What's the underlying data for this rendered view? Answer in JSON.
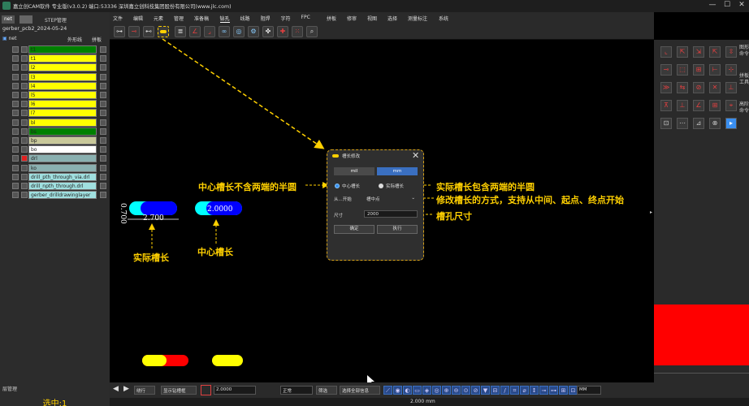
{
  "title": "嘉立创CAM软件 专业版(v3.0.2) 端口:53336    深圳嘉立创科技集团股份有限公司(www.jlc.com)",
  "panel": {
    "tab_net": "net",
    "tab_step": "STEP管理",
    "job": "gerber_pcb2_2024-05-24",
    "net": "net",
    "outline": "外形线",
    "assembly": "拼板",
    "layers_mgr": "层管理",
    "status": "选中:1"
  },
  "layers": [
    {
      "name": "t1",
      "color": "#008000"
    },
    {
      "name": "t1",
      "color": "#ffff00"
    },
    {
      "name": "l2",
      "color": "#ffff00"
    },
    {
      "name": "l3",
      "color": "#ffff00"
    },
    {
      "name": "l4",
      "color": "#ffff00"
    },
    {
      "name": "l5",
      "color": "#ffff00"
    },
    {
      "name": "l6",
      "color": "#ffff00"
    },
    {
      "name": "l7",
      "color": "#ffff00"
    },
    {
      "name": "bl",
      "color": "#ffff00"
    },
    {
      "name": "bs",
      "color": "#008000"
    },
    {
      "name": "bp",
      "color": "#c8c89a"
    },
    {
      "name": "bo",
      "color": "#ffffff"
    },
    {
      "name": "drl",
      "color": "#8ab0b0"
    },
    {
      "name": "ko",
      "color": "#8ab0b0"
    },
    {
      "name": "drill_pth_through_via.drl",
      "color": "#a0e0e0"
    },
    {
      "name": "drill_npth_through.drl",
      "color": "#a0e0e0"
    },
    {
      "name": "gerber_drilldrawinglayer",
      "color": "#a0e0e0"
    }
  ],
  "menu": [
    "文件",
    "编辑",
    "元素",
    "管理",
    "准备稿",
    "钻孔",
    "线路",
    "阻焊",
    "字符",
    "FPC",
    "拼板",
    "修审",
    "视图",
    "选择",
    "测量标注",
    "系统"
  ],
  "active_menu": "钻孔",
  "right_tabs": [
    "图形命令",
    "拼板工具",
    "高阶命令"
  ],
  "dialog": {
    "title": "槽长修改",
    "mil": "mil",
    "mm": "mm",
    "opt_center": "中心槽长",
    "opt_actual": "实际槽长",
    "from_label": "从...开始",
    "from_value": "槽中点",
    "size_label": "尺寸",
    "size_value": "2000",
    "ok": "确定",
    "apply": "执行"
  },
  "annotations": {
    "center_no_half": "中心槽长不含两端的半圆",
    "actual_with_half": "实际槽长包含两端的半圆",
    "modify_mode": "修改槽长的方式，支持从中间、起点、终点开始",
    "slot_size": "槽孔尺寸",
    "actual_slot": "实际槽长",
    "center_slot": "中心槽长"
  },
  "dims": {
    "actual_len": "2.700",
    "width": "0.700",
    "center_len": "2.0000"
  },
  "bottom": {
    "mode": "绕行",
    "show_dims": "显示钻槽框",
    "value": "2.0000",
    "filter": "正常",
    "select": "筛选",
    "sel_all": "选择全部信息",
    "unit": "MM",
    "center_status": "2.000 mm"
  },
  "colors": {
    "accent": "#ffd000",
    "red": "#ff0000",
    "cyan": "#00ffff",
    "blue": "#0000ff",
    "yellow": "#ffff00"
  }
}
